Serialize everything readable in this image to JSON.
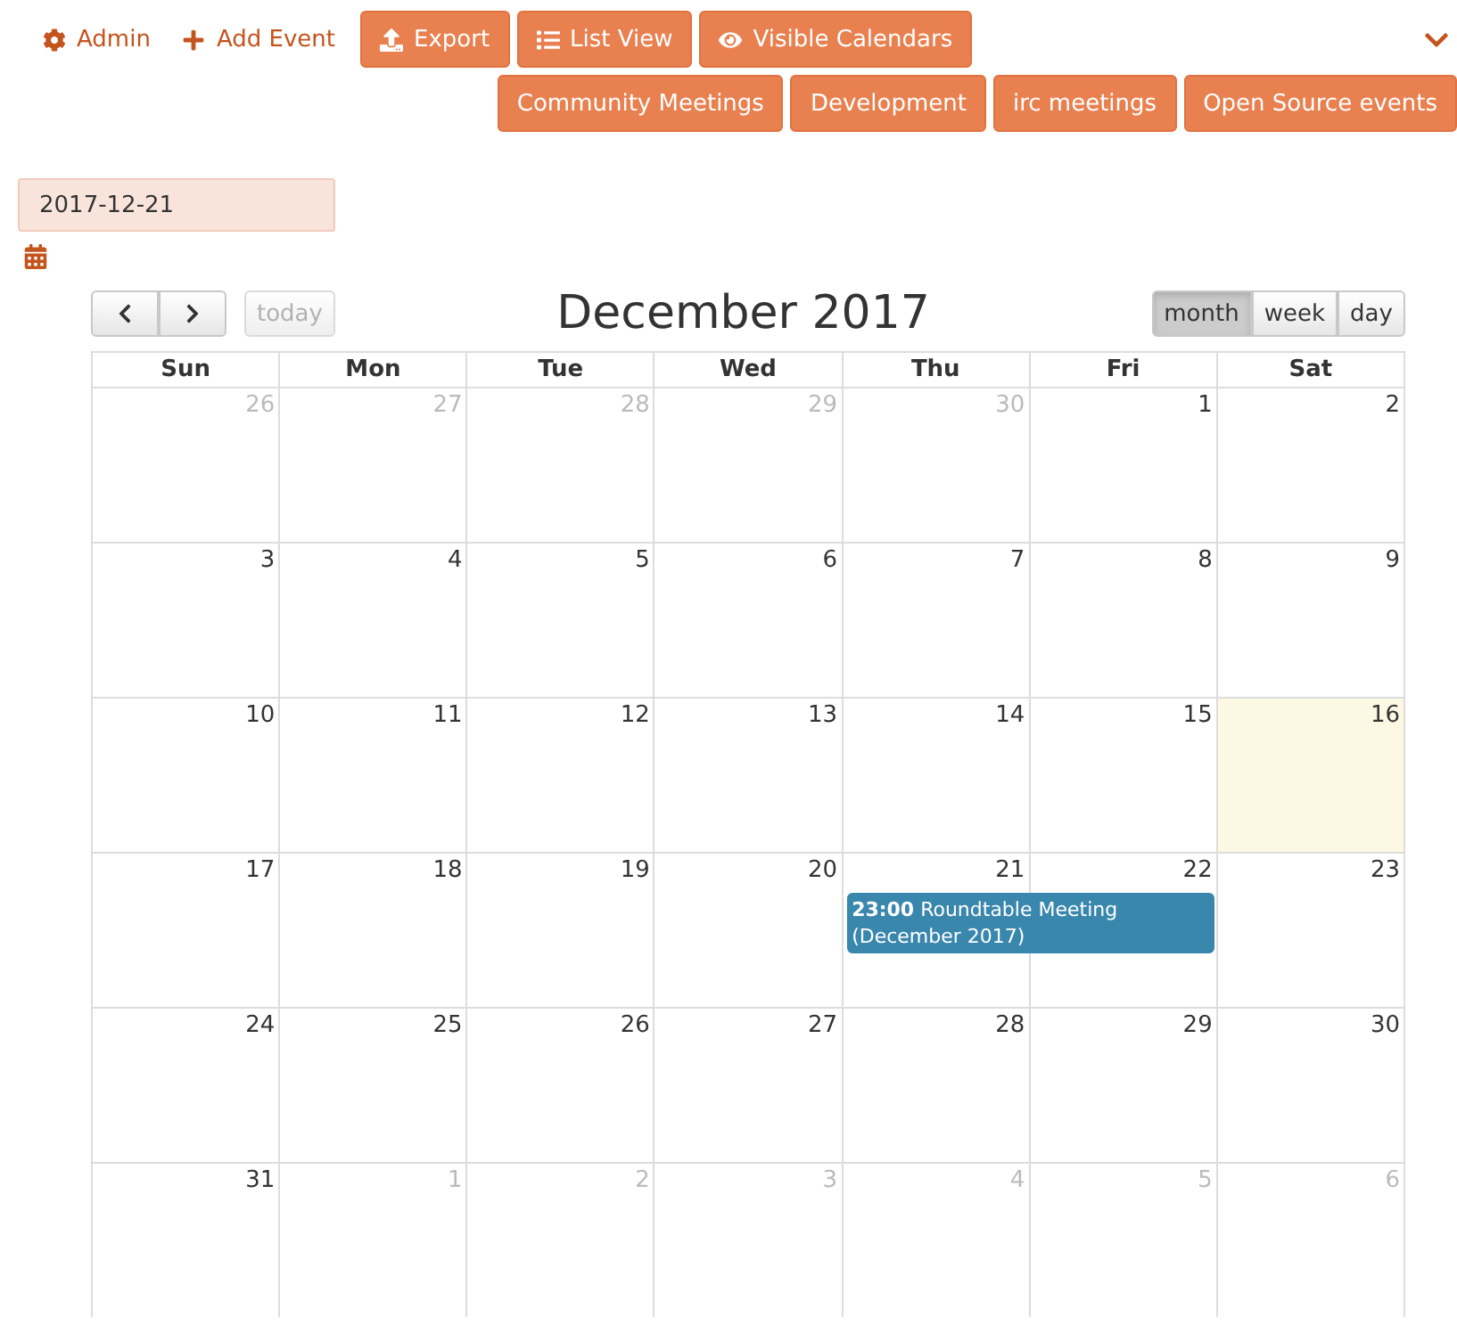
{
  "toolbar": {
    "links": [
      {
        "kind": "gear",
        "label": "Admin"
      },
      {
        "kind": "plus",
        "label": "Add Event"
      }
    ],
    "buttons": [
      {
        "kind": "upload",
        "label": "Export"
      },
      {
        "kind": "list",
        "label": "List View"
      },
      {
        "kind": "eye",
        "label": "Visible Calendars"
      }
    ],
    "calendars": [
      "Community Meetings",
      "Development",
      "irc meetings",
      "Open Source events"
    ]
  },
  "date_field": {
    "value": "2017-12-21"
  },
  "calendar": {
    "title": "December 2017",
    "today_button": {
      "label": "today",
      "disabled": true
    },
    "views": [
      {
        "label": "month",
        "selected": true
      },
      {
        "label": "week",
        "selected": false
      },
      {
        "label": "day",
        "selected": false
      }
    ],
    "weekdays": [
      "Sun",
      "Mon",
      "Tue",
      "Wed",
      "Thu",
      "Fri",
      "Sat"
    ],
    "weeks": [
      [
        {
          "day": "26",
          "other_month": true,
          "today": false
        },
        {
          "day": "27",
          "other_month": true,
          "today": false
        },
        {
          "day": "28",
          "other_month": true,
          "today": false
        },
        {
          "day": "29",
          "other_month": true,
          "today": false
        },
        {
          "day": "30",
          "other_month": true,
          "today": false
        },
        {
          "day": "1",
          "other_month": false,
          "today": false
        },
        {
          "day": "2",
          "other_month": false,
          "today": false
        }
      ],
      [
        {
          "day": "3",
          "other_month": false,
          "today": false
        },
        {
          "day": "4",
          "other_month": false,
          "today": false
        },
        {
          "day": "5",
          "other_month": false,
          "today": false
        },
        {
          "day": "6",
          "other_month": false,
          "today": false
        },
        {
          "day": "7",
          "other_month": false,
          "today": false
        },
        {
          "day": "8",
          "other_month": false,
          "today": false
        },
        {
          "day": "9",
          "other_month": false,
          "today": false
        }
      ],
      [
        {
          "day": "10",
          "other_month": false,
          "today": false
        },
        {
          "day": "11",
          "other_month": false,
          "today": false
        },
        {
          "day": "12",
          "other_month": false,
          "today": false
        },
        {
          "day": "13",
          "other_month": false,
          "today": false
        },
        {
          "day": "14",
          "other_month": false,
          "today": false
        },
        {
          "day": "15",
          "other_month": false,
          "today": false
        },
        {
          "day": "16",
          "other_month": false,
          "today": true
        }
      ],
      [
        {
          "day": "17",
          "other_month": false,
          "today": false
        },
        {
          "day": "18",
          "other_month": false,
          "today": false
        },
        {
          "day": "19",
          "other_month": false,
          "today": false
        },
        {
          "day": "20",
          "other_month": false,
          "today": false
        },
        {
          "day": "21",
          "other_month": false,
          "today": false,
          "event": {
            "text": "**23:00** Roundtable Meeting (December 2017)",
            "continues_next_day": true
          }
        },
        {
          "day": "22",
          "other_month": false,
          "today": false
        },
        {
          "day": "23",
          "other_month": false,
          "today": false
        }
      ],
      [
        {
          "day": "24",
          "other_month": false,
          "today": false
        },
        {
          "day": "25",
          "other_month": false,
          "today": false
        },
        {
          "day": "26",
          "other_month": false,
          "today": false
        },
        {
          "day": "27",
          "other_month": false,
          "today": false
        },
        {
          "day": "28",
          "other_month": false,
          "today": false
        },
        {
          "day": "29",
          "other_month": false,
          "today": false
        },
        {
          "day": "30",
          "other_month": false,
          "today": false
        }
      ],
      [
        {
          "day": "31",
          "other_month": false,
          "today": false
        },
        {
          "day": "1",
          "other_month": true,
          "today": false
        },
        {
          "day": "2",
          "other_month": true,
          "today": false
        },
        {
          "day": "3",
          "other_month": true,
          "today": false
        },
        {
          "day": "4",
          "other_month": true,
          "today": false
        },
        {
          "day": "5",
          "other_month": true,
          "today": false
        },
        {
          "day": "6",
          "other_month": true,
          "today": false
        }
      ]
    ]
  }
}
